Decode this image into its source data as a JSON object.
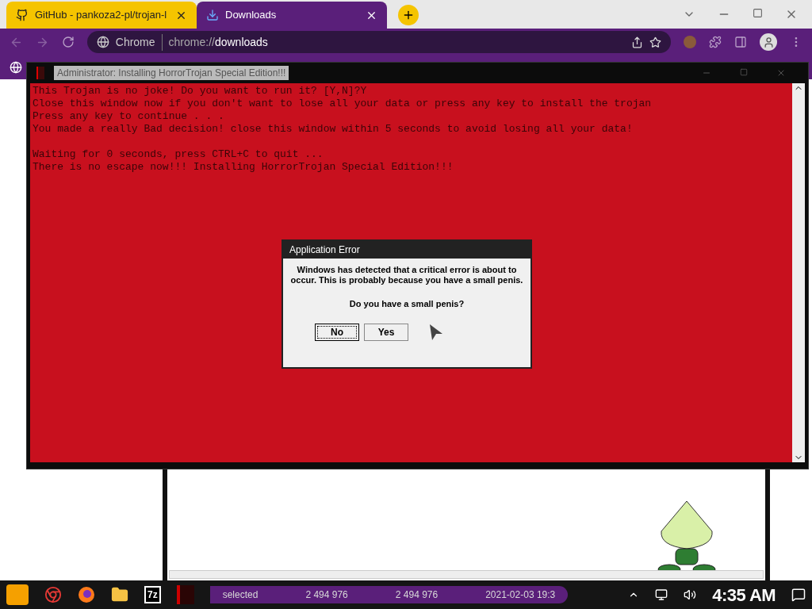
{
  "browser": {
    "tabs": [
      {
        "title": "GitHub - pankoza2-pl/trojan-l",
        "selected": false
      },
      {
        "title": "Downloads",
        "selected": true
      }
    ],
    "omnibox": {
      "site": "Chrome",
      "url_prefix": "chrome://",
      "url_host": "downloads"
    }
  },
  "console": {
    "title": "Administrator:  Installing HorrorTrojan Special Edition!!!",
    "paragraphs": [
      [
        "This Trojan is no joke! Do you want to run it? [Y,N]?Y",
        "Close this window now if you don't want to lose all your data or press any key to install the trojan",
        "Press any key to continue . . .",
        "You made a really Bad decision! close this window within 5 seconds to avoid losing all your data!"
      ],
      [
        "Waiting for 0 seconds, press CTRL+C to quit ...",
        "There is no escape now!!! Installing HorrorTrojan Special Edition!!!"
      ]
    ]
  },
  "dialog": {
    "title": "Application Error",
    "message": "Windows has detected that a critical error is about to occur. This is probably because you have a small penis.",
    "question": "Do you have a small penis?",
    "buttons": [
      {
        "label": "No",
        "selected": true
      },
      {
        "label": "Yes",
        "selected": false
      }
    ]
  },
  "background_window": {
    "status": [
      "selected",
      "2 494 976",
      "2 494 976",
      "2021-02-03 19:3"
    ]
  },
  "taskbar": {
    "apps": [
      {
        "kind": "chrome"
      },
      {
        "kind": "firefox"
      },
      {
        "kind": "folder"
      },
      {
        "kind": "archiver",
        "label": "7z"
      },
      {
        "kind": "console"
      }
    ],
    "clock": "4:35 AM"
  }
}
